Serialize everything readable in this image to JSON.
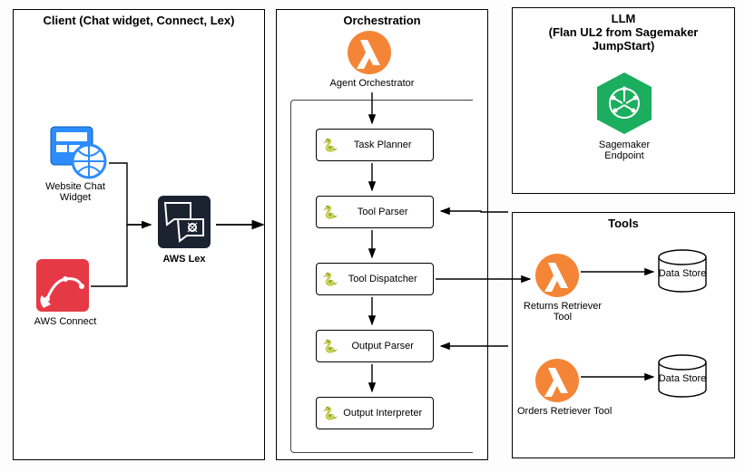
{
  "client": {
    "title": "Client (Chat widget, Connect, Lex)",
    "widget_label": "Website Chat Widget",
    "connect_label": "AWS Connect",
    "lex_label": "AWS Lex"
  },
  "orchestration": {
    "title": "Orchestration",
    "orchestrator_label": "Agent Orchestrator",
    "steps": {
      "planner": "Task Planner",
      "tool_parser": "Tool Parser",
      "dispatcher": "Tool Dispatcher",
      "output_parser": "Output Parser",
      "interpreter": "Output Interpreter"
    }
  },
  "llm": {
    "title_line1": "LLM",
    "title_line2": "(Flan UL2 from Sagemaker",
    "title_line3": "JumpStart)",
    "endpoint_label": "Sagemaker Endpoint"
  },
  "tools": {
    "title": "Tools",
    "returns_label": "Returns Retriever Tool",
    "orders_label": "Orders Retriever Tool",
    "datastore_label": "Data Store"
  }
}
